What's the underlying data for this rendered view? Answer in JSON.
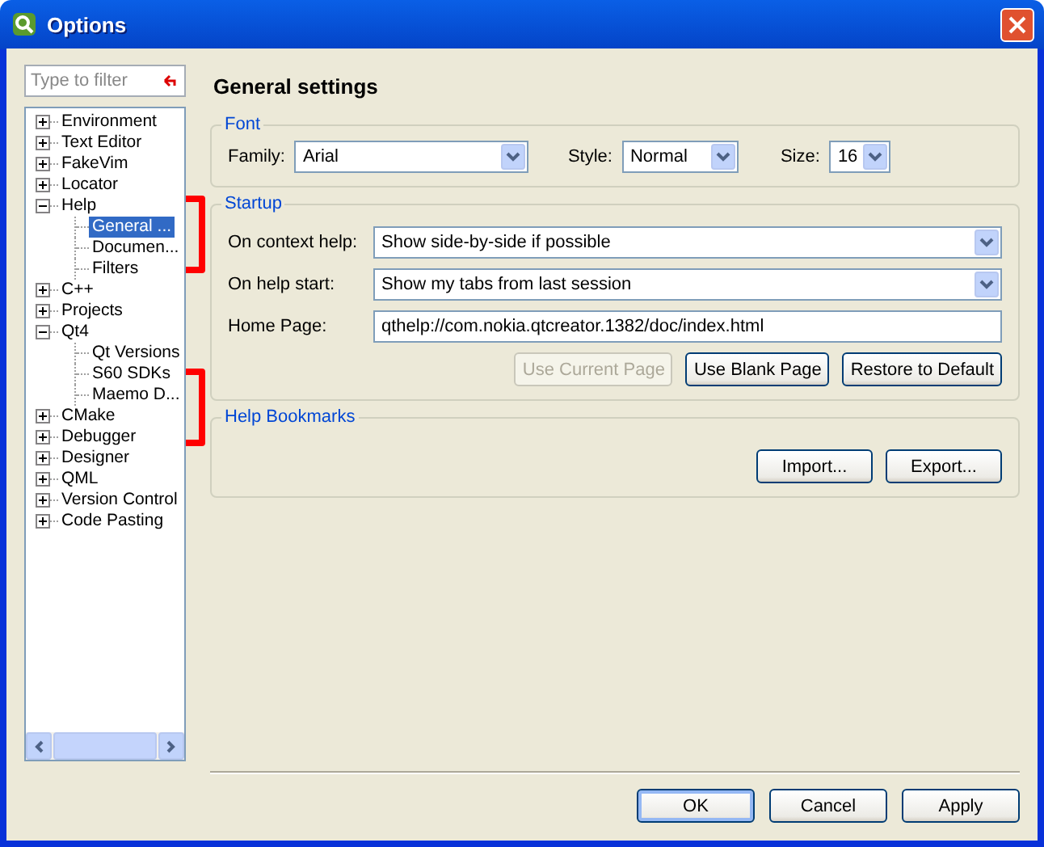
{
  "window": {
    "title": "Options"
  },
  "filter": {
    "placeholder": "Type to filter"
  },
  "tree": [
    {
      "label": "Environment",
      "expanded": false,
      "selected": false
    },
    {
      "label": "Text Editor",
      "expanded": false,
      "selected": false
    },
    {
      "label": "FakeVim",
      "expanded": false,
      "selected": false
    },
    {
      "label": "Locator",
      "expanded": false,
      "selected": false
    },
    {
      "label": "Help",
      "expanded": true,
      "selected": false,
      "children": [
        {
          "label": "General ...",
          "selected": true
        },
        {
          "label": "Documen...",
          "selected": false
        },
        {
          "label": "Filters",
          "selected": false
        }
      ]
    },
    {
      "label": "C++",
      "expanded": false,
      "selected": false
    },
    {
      "label": "Projects",
      "expanded": false,
      "selected": false
    },
    {
      "label": "Qt4",
      "expanded": true,
      "selected": false,
      "children": [
        {
          "label": "Qt Versions",
          "selected": false
        },
        {
          "label": "S60 SDKs",
          "selected": false
        },
        {
          "label": "Maemo D...",
          "selected": false
        }
      ]
    },
    {
      "label": "CMake",
      "expanded": false,
      "selected": false
    },
    {
      "label": "Debugger",
      "expanded": false,
      "selected": false
    },
    {
      "label": "Designer",
      "expanded": false,
      "selected": false
    },
    {
      "label": "QML",
      "expanded": false,
      "selected": false
    },
    {
      "label": "Version Control",
      "expanded": false,
      "selected": false
    },
    {
      "label": "Code Pasting",
      "expanded": false,
      "selected": false
    }
  ],
  "page": {
    "title": "General settings",
    "font": {
      "title": "Font",
      "family_label": "Family:",
      "family": "Arial",
      "style_label": "Style:",
      "style": "Normal",
      "size_label": "Size:",
      "size": "16"
    },
    "startup": {
      "title": "Startup",
      "context_label": "On context help:",
      "context": "Show side-by-side if possible",
      "start_label": "On help start:",
      "start": "Show my tabs from last session",
      "home_label": "Home Page:",
      "home": "qthelp://com.nokia.qtcreator.1382/doc/index.html",
      "buttons": [
        {
          "label": "Use Current Page",
          "disabled": true
        },
        {
          "label": "Use Blank Page",
          "disabled": false
        },
        {
          "label": "Restore to Default",
          "disabled": false
        }
      ]
    },
    "bookmarks": {
      "title": "Help Bookmarks",
      "buttons": [
        "Import...",
        "Export..."
      ]
    }
  },
  "buttons": [
    {
      "label": "OK",
      "default": true
    },
    {
      "label": "Cancel",
      "default": false
    },
    {
      "label": "Apply",
      "default": false
    }
  ]
}
